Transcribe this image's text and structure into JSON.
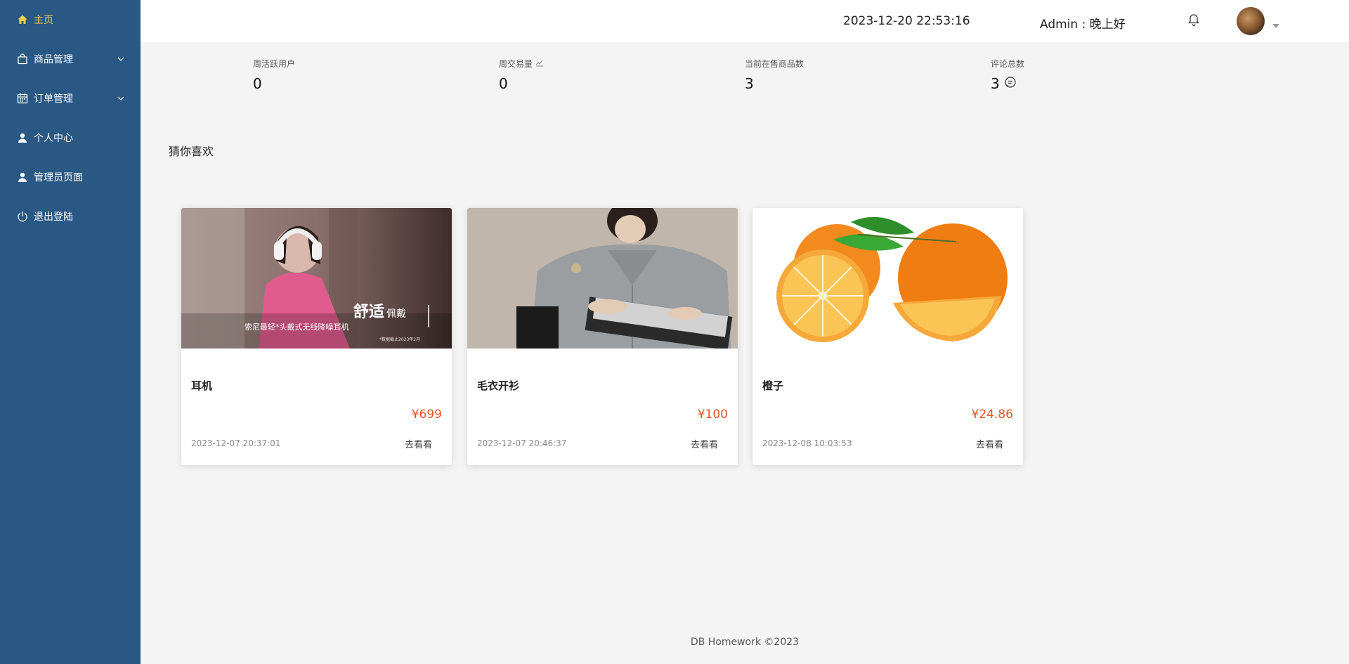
{
  "sidebar": {
    "items": [
      {
        "label": "主页",
        "icon": "home-icon"
      },
      {
        "label": "商品管理",
        "icon": "bag-icon"
      },
      {
        "label": "订单管理",
        "icon": "calendar-icon"
      },
      {
        "label": "个人中心",
        "icon": "user-icon"
      },
      {
        "label": "管理员页面",
        "icon": "user-icon"
      },
      {
        "label": "退出登陆",
        "icon": "power-icon"
      }
    ],
    "active_color": "#ffd04b",
    "background": "#2a5884"
  },
  "header": {
    "datetime": "2023-12-20 22:53:16",
    "greeting": "Admin : 晚上好"
  },
  "stats": [
    {
      "label": "周活跃用户",
      "value": "0"
    },
    {
      "label": "周交易量",
      "value": "0"
    },
    {
      "label": "当前在售商品数",
      "value": "3"
    },
    {
      "label": "评论总数",
      "value": "3"
    }
  ],
  "section_title": "猜你喜欢",
  "products": [
    {
      "name": "耳机",
      "price": "¥699",
      "time": "2023-12-07 20:37:01",
      "link": "去看看",
      "image_text": {
        "headline": "舒适",
        "headline_sub": "佩戴",
        "line": "索尼最轻*头戴式无线降噪耳机",
        "note": "*数据截止2023年2月"
      }
    },
    {
      "name": "毛衣开衫",
      "price": "¥100",
      "time": "2023-12-07 20:46:37",
      "link": "去看看"
    },
    {
      "name": "橙子",
      "price": "¥24.86",
      "time": "2023-12-08 10:03:53",
      "link": "去看看"
    }
  ],
  "price_color": "#e75424",
  "footer": "DB Homework ©2023"
}
